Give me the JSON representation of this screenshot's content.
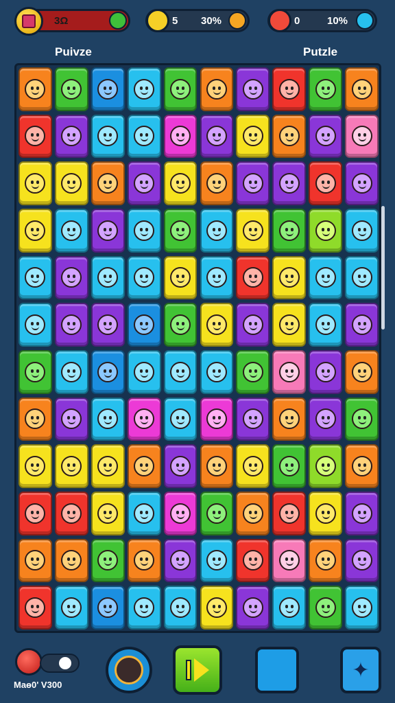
{
  "hud": {
    "score_value": "3Ω",
    "moves_value": "5",
    "moves_percent": "30%",
    "lives_value": "0",
    "lives_percent": "10%"
  },
  "labels": {
    "left": "Puivze",
    "right": "Putzle"
  },
  "bottom": {
    "label": "Maɵ0' V300"
  },
  "icons": {
    "gift": "gift-icon",
    "leaf": "leaf-icon",
    "face": "face-icon",
    "apple": "apple-icon",
    "play": "play-icon",
    "star": "star-icon"
  },
  "colors": {
    "red": "#f0342c",
    "orange": "#f7831e",
    "yellow": "#f6e21e",
    "green": "#41c334",
    "lime": "#8fdb2a",
    "cyan": "#27c0ee",
    "blue": "#1b8fe0",
    "purple": "#8a36d8",
    "magenta": "#ec3ad6",
    "pink": "#f77ab8"
  },
  "board": {
    "rows": [
      [
        "orange",
        "green",
        "blue",
        "cyan",
        "green",
        "orange",
        "purple",
        "red",
        "green",
        "orange"
      ],
      [
        "red",
        "purple",
        "cyan",
        "cyan",
        "magenta",
        "purple",
        "yellow",
        "orange",
        "purple",
        "pink"
      ],
      [
        "yellow",
        "yellow",
        "orange",
        "purple",
        "yellow",
        "orange",
        "purple",
        "purple",
        "red",
        "purple"
      ],
      [
        "yellow",
        "cyan",
        "purple",
        "cyan",
        "green",
        "cyan",
        "yellow",
        "green",
        "lime",
        "cyan"
      ],
      [
        "cyan",
        "purple",
        "cyan",
        "cyan",
        "yellow",
        "cyan",
        "red",
        "yellow",
        "cyan",
        "cyan"
      ],
      [
        "cyan",
        "purple",
        "purple",
        "blue",
        "green",
        "yellow",
        "purple",
        "yellow",
        "cyan",
        "purple"
      ],
      [
        "green",
        "cyan",
        "blue",
        "cyan",
        "cyan",
        "cyan",
        "green",
        "pink",
        "purple",
        "orange"
      ],
      [
        "orange",
        "purple",
        "cyan",
        "magenta",
        "cyan",
        "magenta",
        "purple",
        "orange",
        "purple",
        "green"
      ],
      [
        "yellow",
        "yellow",
        "yellow",
        "orange",
        "purple",
        "orange",
        "yellow",
        "green",
        "lime",
        "orange"
      ],
      [
        "red",
        "red",
        "yellow",
        "cyan",
        "magenta",
        "green",
        "orange",
        "red",
        "yellow",
        "purple"
      ],
      [
        "orange",
        "orange",
        "green",
        "orange",
        "purple",
        "cyan",
        "red",
        "pink",
        "orange",
        "purple"
      ],
      [
        "red",
        "cyan",
        "blue",
        "cyan",
        "cyan",
        "yellow",
        "purple",
        "cyan",
        "green",
        "cyan"
      ]
    ]
  }
}
